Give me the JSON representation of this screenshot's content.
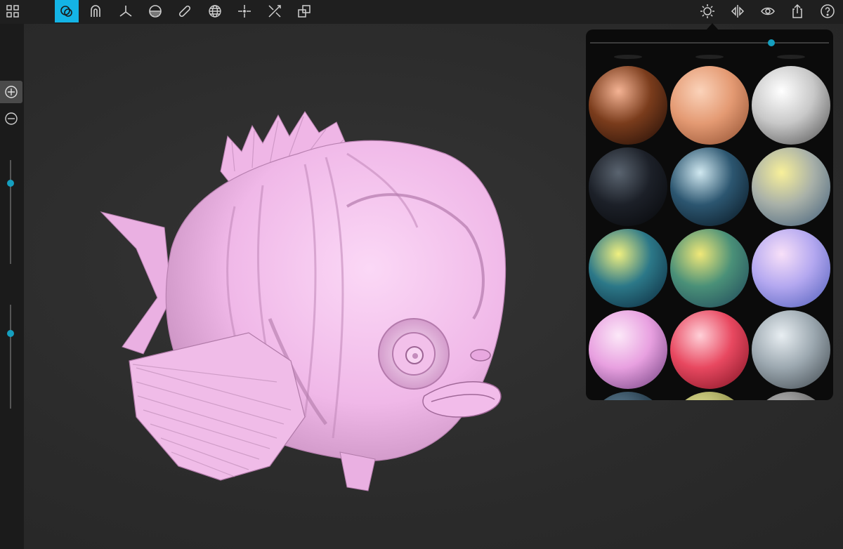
{
  "toolbar": {
    "left": [
      {
        "name": "grid-menu-icon",
        "active": false
      },
      {
        "name": "sculpt-tool-icon",
        "active": true
      },
      {
        "name": "magnet-tool-icon",
        "active": false
      },
      {
        "name": "axis-tool-icon",
        "active": false
      },
      {
        "name": "plane-tool-icon",
        "active": false
      },
      {
        "name": "bandage-tool-icon",
        "active": false
      },
      {
        "name": "globe-tool-icon",
        "active": false
      },
      {
        "name": "move-tool-icon",
        "active": false
      },
      {
        "name": "scale-tool-icon",
        "active": false
      },
      {
        "name": "transform-tool-icon",
        "active": false
      }
    ],
    "right": [
      {
        "name": "light-icon"
      },
      {
        "name": "symmetry-icon"
      },
      {
        "name": "eye-icon"
      },
      {
        "name": "share-icon"
      },
      {
        "name": "help-icon"
      }
    ],
    "accent_color": "#14b4e6"
  },
  "sidebar": {
    "buttons": [
      {
        "name": "zoom-in-icon",
        "active": true
      },
      {
        "name": "zoom-out-icon",
        "active": false
      }
    ],
    "sliders": [
      {
        "name": "brush-size-slider",
        "value": 0.22
      },
      {
        "name": "brush-intensity-slider",
        "value": 0.28
      }
    ]
  },
  "matcap_panel": {
    "intensity": 0.76,
    "matcaps": [
      {
        "name": "matcap-bronze",
        "highlight": "#f4b394",
        "base": "#7a3c1c",
        "dark": "#1a0a05"
      },
      {
        "name": "matcap-peach",
        "highlight": "#fbd3ba",
        "base": "#e49a73",
        "dark": "#8a4a2c"
      },
      {
        "name": "matcap-white",
        "highlight": "#ffffff",
        "base": "#c8c8c8",
        "dark": "#4a4a4a"
      },
      {
        "name": "matcap-black-rim",
        "highlight": "#5a6470",
        "base": "#1c2028",
        "dark": "#050608"
      },
      {
        "name": "matcap-blue-chrome",
        "highlight": "#d0e8f0",
        "base": "#2c5670",
        "dark": "#06121c"
      },
      {
        "name": "matcap-yellow-gray",
        "highlight": "#f8f09a",
        "base": "#a8b0a8",
        "dark": "#3c5a78"
      },
      {
        "name": "matcap-teal-yellow",
        "highlight": "#f0f080",
        "base": "#2c7888",
        "dark": "#0a2438"
      },
      {
        "name": "matcap-green-gold",
        "highlight": "#f0e878",
        "base": "#4a9078",
        "dark": "#1c4258"
      },
      {
        "name": "matcap-lavender",
        "highlight": "#f8e0f8",
        "base": "#b4a8f0",
        "dark": "#4a5ab8"
      },
      {
        "name": "matcap-pink",
        "highlight": "#fce8f8",
        "base": "#e8a0e0",
        "dark": "#6a3a7a"
      },
      {
        "name": "matcap-red",
        "highlight": "#ffd0d8",
        "base": "#e84860",
        "dark": "#7a1020"
      },
      {
        "name": "matcap-silver",
        "highlight": "#e8eef2",
        "base": "#9ca8b0",
        "dark": "#3a4248"
      },
      {
        "name": "matcap-partial-1",
        "highlight": "#6a8aa0",
        "base": "#304858",
        "dark": "#101a22"
      },
      {
        "name": "matcap-partial-2",
        "highlight": "#f0f0a0",
        "base": "#a8a860",
        "dark": "#404020"
      },
      {
        "name": "matcap-partial-3",
        "highlight": "#c8c8c8",
        "base": "#808080",
        "dark": "#303030"
      }
    ]
  },
  "model": {
    "name": "fish-sculpt",
    "color": "#f0b8e8",
    "shadow": "#b078a8"
  }
}
